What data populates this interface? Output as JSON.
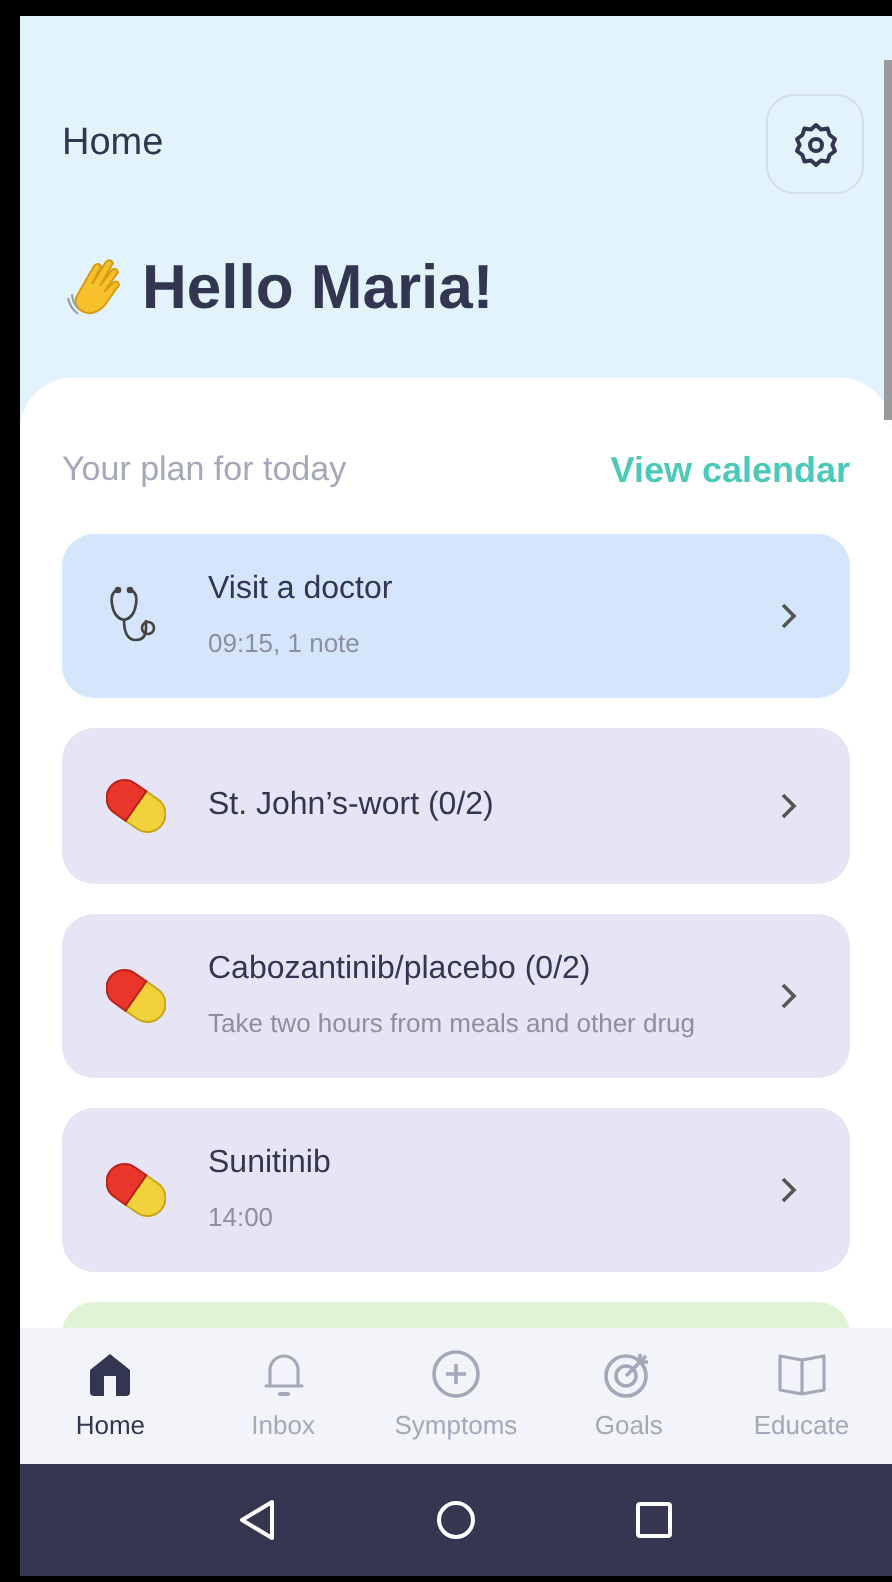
{
  "header": {
    "title": "Home",
    "greeting": "Hello Maria!"
  },
  "plan": {
    "heading": "Your plan for today",
    "link": "View calendar",
    "items": [
      {
        "kind": "appointment",
        "title": "Visit a doctor",
        "subtitle": "09:15, 1 note"
      },
      {
        "kind": "medication",
        "title": "St. John’s-wort (0/2)"
      },
      {
        "kind": "medication",
        "title": "Cabozantinib/placebo (0/2)",
        "subtitle": "Take two hours from meals and other drug"
      },
      {
        "kind": "medication",
        "title": "Sunitinib",
        "subtitle": "14:00"
      }
    ]
  },
  "tabs": [
    {
      "label": "Home",
      "kind": "home",
      "selected": true
    },
    {
      "label": "Inbox",
      "kind": "inbox",
      "selected": false
    },
    {
      "label": "Symptoms",
      "kind": "symptoms",
      "selected": false
    },
    {
      "label": "Goals",
      "kind": "goals",
      "selected": false
    },
    {
      "label": "Educate",
      "kind": "educate",
      "selected": false
    }
  ]
}
